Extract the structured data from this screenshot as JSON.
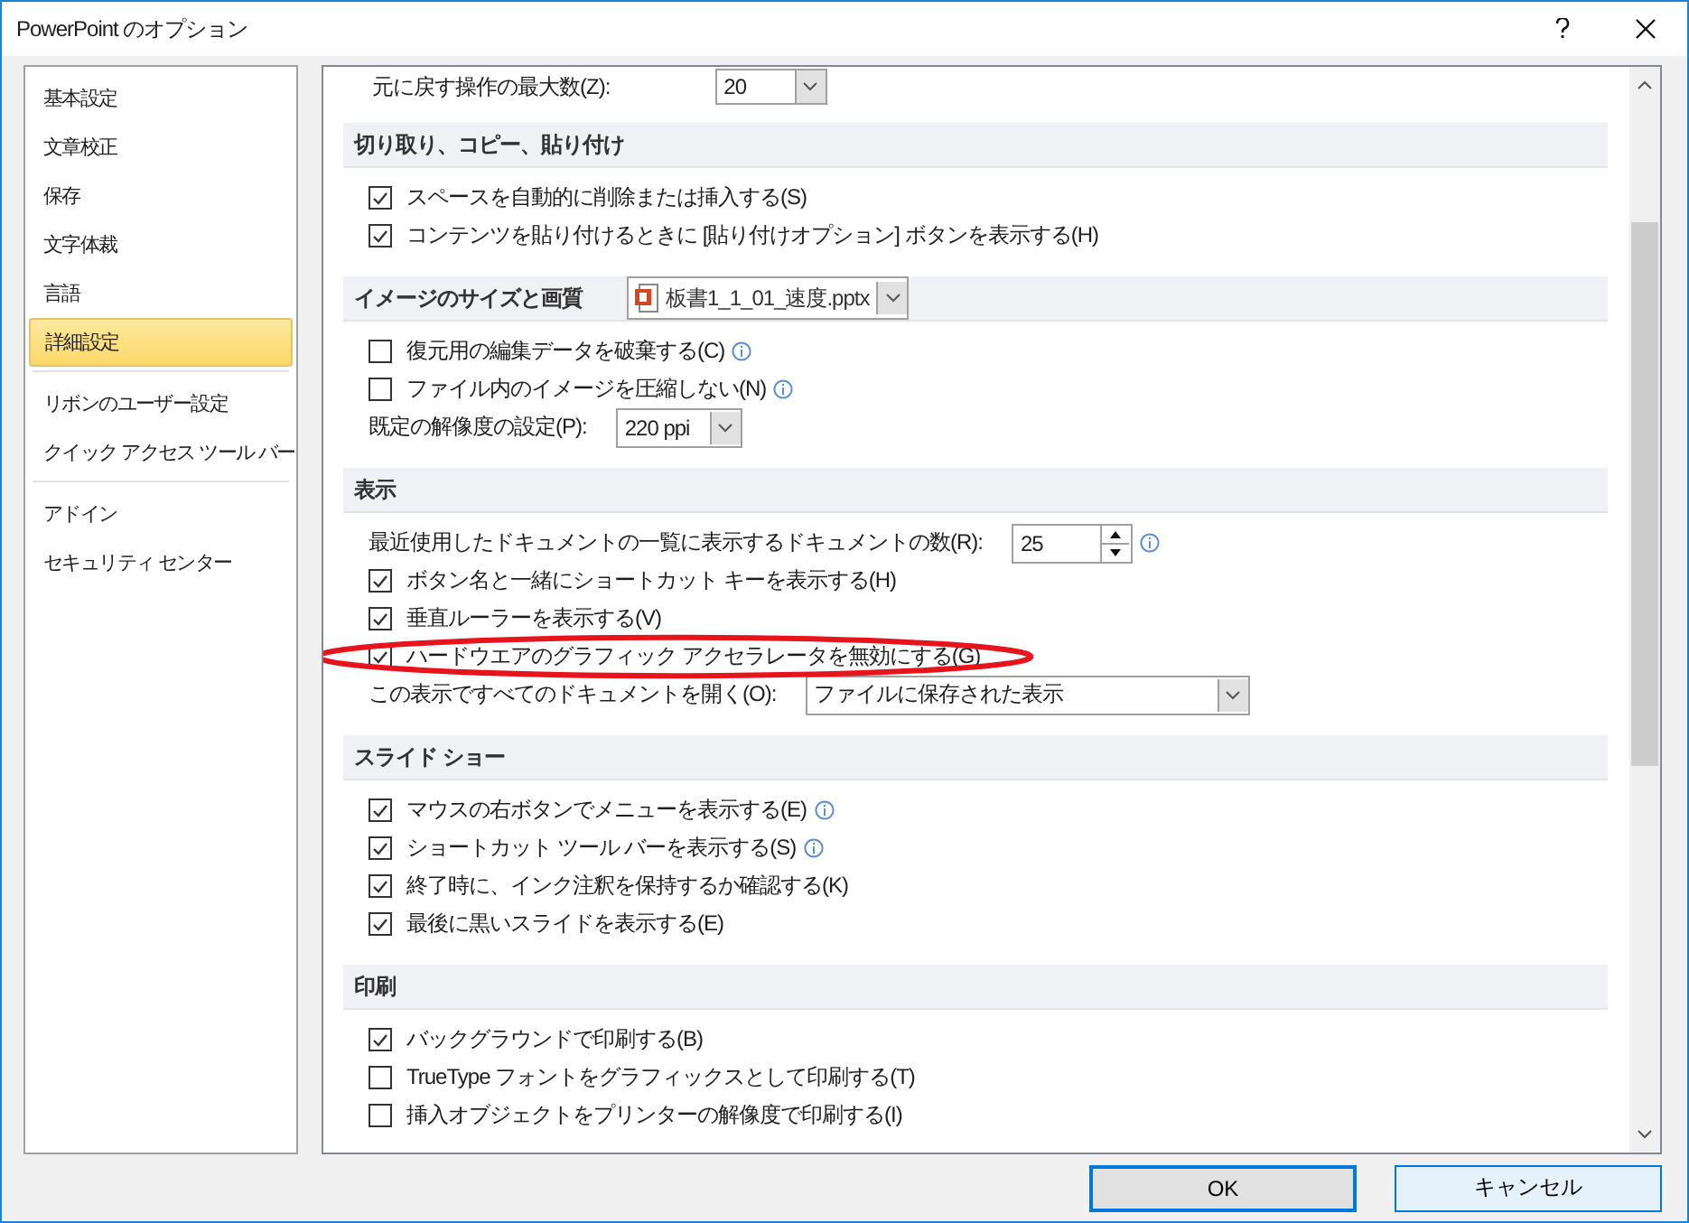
{
  "window": {
    "title": "PowerPoint のオプション"
  },
  "sidebar": {
    "groups": [
      [
        {
          "label": "基本設定",
          "selected": false
        },
        {
          "label": "文章校正",
          "selected": false
        },
        {
          "label": "保存",
          "selected": false
        },
        {
          "label": "文字体裁",
          "selected": false
        },
        {
          "label": "言語",
          "selected": false
        },
        {
          "label": "詳細設定",
          "selected": true
        }
      ],
      [
        {
          "label": "リボンのユーザー設定",
          "selected": false
        },
        {
          "label": "クイック アクセス ツール バー",
          "selected": false
        }
      ],
      [
        {
          "label": "アドイン",
          "selected": false
        },
        {
          "label": "セキュリティ センター",
          "selected": false
        }
      ]
    ]
  },
  "top_row": {
    "label": "元に戻す操作の最大数(Z):",
    "value": "20"
  },
  "sections": [
    {
      "title": "切り取り、コピー、貼り付け",
      "items": [
        {
          "kind": "check",
          "label": "スペースを自動的に削除または挿入する(S)",
          "checked": true,
          "info": false
        },
        {
          "kind": "check",
          "label": "コンテンツを貼り付けるときに [貼り付けオプション] ボタンを表示する(H)",
          "checked": true,
          "info": false
        }
      ]
    },
    {
      "title": "イメージのサイズと画質",
      "file": "板書1_1_01_速度.pptx",
      "items": [
        {
          "kind": "check",
          "label": "復元用の編集データを破棄する(C)",
          "checked": false,
          "info": true
        },
        {
          "kind": "check",
          "label": "ファイル内のイメージを圧縮しない(N)",
          "checked": false,
          "info": true
        },
        {
          "kind": "select",
          "label": "既定の解像度の設定(P):",
          "value": "220 ppi",
          "info": false
        }
      ]
    },
    {
      "title": "表示",
      "items": [
        {
          "kind": "spin",
          "label": "最近使用したドキュメントの一覧に表示するドキュメントの数(R):",
          "value": "25",
          "info": true
        },
        {
          "kind": "check",
          "label": "ボタン名と一緒にショートカット キーを表示する(H)",
          "checked": true,
          "info": false
        },
        {
          "kind": "check",
          "label": "垂直ルーラーを表示する(V)",
          "checked": true,
          "info": false
        },
        {
          "kind": "check",
          "label": "ハードウエアのグラフィック アクセラレータを無効にする(G)",
          "checked": true,
          "info": false,
          "highlighted": true
        },
        {
          "kind": "wideselect",
          "label": "この表示ですべてのドキュメントを開く(O):",
          "value": "ファイルに保存された表示",
          "info": false
        }
      ]
    },
    {
      "title": "スライド ショー",
      "items": [
        {
          "kind": "check",
          "label": "マウスの右ボタンでメニューを表示する(E)",
          "checked": true,
          "info": true
        },
        {
          "kind": "check",
          "label": "ショートカット ツール バーを表示する(S)",
          "checked": true,
          "info": true
        },
        {
          "kind": "check",
          "label": "終了時に、インク注釈を保持するか確認する(K)",
          "checked": true,
          "info": false
        },
        {
          "kind": "check",
          "label": "最後に黒いスライドを表示する(E)",
          "checked": true,
          "info": false
        }
      ]
    },
    {
      "title": "印刷",
      "items": [
        {
          "kind": "check",
          "label": "バックグラウンドで印刷する(B)",
          "checked": true,
          "info": false
        },
        {
          "kind": "check",
          "label": "TrueType フォントをグラフィックスとして印刷する(T)",
          "checked": false,
          "info": false
        },
        {
          "kind": "check",
          "label": "挿入オブジェクトをプリンターの解像度で印刷する(I)",
          "checked": false,
          "info": false
        }
      ]
    }
  ],
  "buttons": [
    {
      "label": "OK",
      "default": true
    },
    {
      "label": "キャンセル",
      "default": false
    }
  ]
}
